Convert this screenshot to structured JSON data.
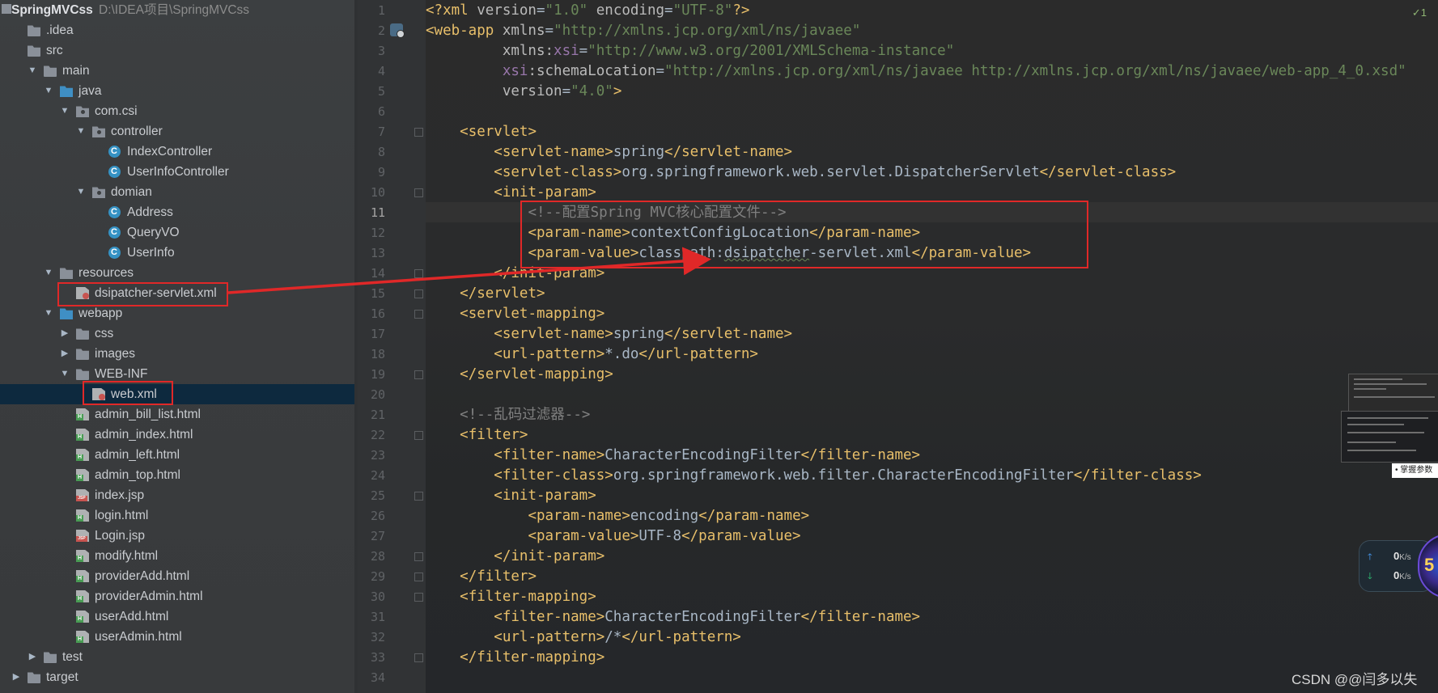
{
  "project": {
    "name": "SpringMVCss",
    "path": "D:\\IDEA项目\\SpringMVCss"
  },
  "tree": [
    {
      "label": "SpringMVCss",
      "indent": 0,
      "arrow": "",
      "icon": "module-icon"
    },
    {
      "label": ".idea",
      "indent": 0,
      "arrow": "",
      "icon": "folder-icon"
    },
    {
      "label": "src",
      "indent": 0,
      "arrow": "",
      "icon": "folder-icon"
    },
    {
      "label": "main",
      "indent": 1,
      "arrow": "open",
      "icon": "folder-icon"
    },
    {
      "label": "java",
      "indent": 2,
      "arrow": "open",
      "icon": "source-folder-icon"
    },
    {
      "label": "com.csi",
      "indent": 3,
      "arrow": "open",
      "icon": "package-icon"
    },
    {
      "label": "controller",
      "indent": 4,
      "arrow": "open",
      "icon": "package-icon"
    },
    {
      "label": "IndexController",
      "indent": 5,
      "arrow": "",
      "icon": "java-class-icon"
    },
    {
      "label": "UserInfoController",
      "indent": 5,
      "arrow": "",
      "icon": "java-class-icon"
    },
    {
      "label": "domian",
      "indent": 4,
      "arrow": "open",
      "icon": "package-icon"
    },
    {
      "label": "Address",
      "indent": 5,
      "arrow": "",
      "icon": "java-class-icon"
    },
    {
      "label": "QueryVO",
      "indent": 5,
      "arrow": "",
      "icon": "java-class-icon"
    },
    {
      "label": "UserInfo",
      "indent": 5,
      "arrow": "",
      "icon": "java-class-icon"
    },
    {
      "label": "resources",
      "indent": 2,
      "arrow": "open",
      "icon": "resources-folder-icon"
    },
    {
      "label": "dsipatcher-servlet.xml",
      "indent": 3,
      "arrow": "",
      "icon": "spring-xml-icon"
    },
    {
      "label": "webapp",
      "indent": 2,
      "arrow": "open",
      "icon": "web-folder-icon"
    },
    {
      "label": "css",
      "indent": 3,
      "arrow": "closed",
      "icon": "folder-icon"
    },
    {
      "label": "images",
      "indent": 3,
      "arrow": "closed",
      "icon": "folder-icon"
    },
    {
      "label": "WEB-INF",
      "indent": 3,
      "arrow": "open",
      "icon": "folder-icon"
    },
    {
      "label": "web.xml",
      "indent": 4,
      "arrow": "",
      "icon": "web-xml-icon",
      "selected": true
    },
    {
      "label": "admin_bill_list.html",
      "indent": 3,
      "arrow": "",
      "icon": "html-file-icon"
    },
    {
      "label": "admin_index.html",
      "indent": 3,
      "arrow": "",
      "icon": "html-file-icon"
    },
    {
      "label": "admin_left.html",
      "indent": 3,
      "arrow": "",
      "icon": "html-file-icon"
    },
    {
      "label": "admin_top.html",
      "indent": 3,
      "arrow": "",
      "icon": "html-file-icon"
    },
    {
      "label": "index.jsp",
      "indent": 3,
      "arrow": "",
      "icon": "jsp-file-icon"
    },
    {
      "label": "login.html",
      "indent": 3,
      "arrow": "",
      "icon": "html-file-icon"
    },
    {
      "label": "Login.jsp",
      "indent": 3,
      "arrow": "",
      "icon": "jsp-file-icon"
    },
    {
      "label": "modify.html",
      "indent": 3,
      "arrow": "",
      "icon": "html-file-icon"
    },
    {
      "label": "providerAdd.html",
      "indent": 3,
      "arrow": "",
      "icon": "html-file-icon"
    },
    {
      "label": "providerAdmin.html",
      "indent": 3,
      "arrow": "",
      "icon": "html-file-icon"
    },
    {
      "label": "userAdd.html",
      "indent": 3,
      "arrow": "",
      "icon": "html-file-icon"
    },
    {
      "label": "userAdmin.html",
      "indent": 3,
      "arrow": "",
      "icon": "html-file-icon"
    },
    {
      "label": "test",
      "indent": 1,
      "arrow": "closed",
      "icon": "folder-icon"
    },
    {
      "label": "target",
      "indent": 0,
      "arrow": "closed",
      "icon": "target-folder-icon"
    }
  ],
  "editor": {
    "inspection_badge": "✓1",
    "current_line": 11,
    "lines": [
      [
        [
          "pi",
          "<?xml "
        ],
        [
          "attr",
          "version"
        ],
        [
          "txt",
          "="
        ],
        [
          "val",
          "\"1.0\""
        ],
        [
          "attr",
          " encoding"
        ],
        [
          "txt",
          "="
        ],
        [
          "val",
          "\"UTF-8\""
        ],
        [
          "pi",
          "?>"
        ]
      ],
      [
        [
          "tag",
          "<web-app "
        ],
        [
          "attr",
          "xmlns"
        ],
        [
          "txt",
          "="
        ],
        [
          "val",
          "\"http://xmlns.jcp.org/xml/ns/javaee\""
        ]
      ],
      [
        [
          "txt",
          "         "
        ],
        [
          "attr",
          "xmlns:"
        ],
        [
          "ns",
          "xsi"
        ],
        [
          "txt",
          "="
        ],
        [
          "val",
          "\"http://www.w3.org/2001/XMLSchema-instance\""
        ]
      ],
      [
        [
          "txt",
          "         "
        ],
        [
          "ns",
          "xsi"
        ],
        [
          "attr",
          ":schemaLocation"
        ],
        [
          "txt",
          "="
        ],
        [
          "val",
          "\"http://xmlns.jcp.org/xml/ns/javaee http://xmlns.jcp.org/xml/ns/javaee/web-app_4_0.xsd\""
        ]
      ],
      [
        [
          "txt",
          "         "
        ],
        [
          "attr",
          "version"
        ],
        [
          "txt",
          "="
        ],
        [
          "val",
          "\"4.0\""
        ],
        [
          "tag",
          ">"
        ]
      ],
      [],
      [
        [
          "txt",
          "    "
        ],
        [
          "tag",
          "<servlet>"
        ]
      ],
      [
        [
          "txt",
          "        "
        ],
        [
          "tag",
          "<servlet-name>"
        ],
        [
          "txt",
          "spring"
        ],
        [
          "tag",
          "</servlet-name>"
        ]
      ],
      [
        [
          "txt",
          "        "
        ],
        [
          "tag",
          "<servlet-class>"
        ],
        [
          "txt",
          "org.springframework.web.servlet.DispatcherServlet"
        ],
        [
          "tag",
          "</servlet-class>"
        ]
      ],
      [
        [
          "txt",
          "        "
        ],
        [
          "tag",
          "<init-param>"
        ]
      ],
      [
        [
          "txt",
          "            "
        ],
        [
          "cmt",
          "<!--配置Spring MVC核心配置文件-->"
        ]
      ],
      [
        [
          "txt",
          "            "
        ],
        [
          "tag",
          "<param-name>"
        ],
        [
          "txt",
          "contextConfigLocation"
        ],
        [
          "tag",
          "</param-name>"
        ]
      ],
      [
        [
          "txt",
          "            "
        ],
        [
          "tag",
          "<param-value>"
        ],
        [
          "txt",
          "classpath:"
        ],
        [
          "squig",
          "dsipatcher"
        ],
        [
          "txt",
          "-servlet.xml"
        ],
        [
          "tag",
          "</param-value>"
        ]
      ],
      [
        [
          "txt",
          "        "
        ],
        [
          "tag",
          "</init-param>"
        ]
      ],
      [
        [
          "txt",
          "    "
        ],
        [
          "tag",
          "</servlet>"
        ]
      ],
      [
        [
          "txt",
          "    "
        ],
        [
          "tag",
          "<servlet-mapping>"
        ]
      ],
      [
        [
          "txt",
          "        "
        ],
        [
          "tag",
          "<servlet-name>"
        ],
        [
          "txt",
          "spring"
        ],
        [
          "tag",
          "</servlet-name>"
        ]
      ],
      [
        [
          "txt",
          "        "
        ],
        [
          "tag",
          "<url-pattern>"
        ],
        [
          "txt",
          "*.do"
        ],
        [
          "tag",
          "</url-pattern>"
        ]
      ],
      [
        [
          "txt",
          "    "
        ],
        [
          "tag",
          "</servlet-mapping>"
        ]
      ],
      [],
      [
        [
          "txt",
          "    "
        ],
        [
          "cmt",
          "<!--乱码过滤器-->"
        ]
      ],
      [
        [
          "txt",
          "    "
        ],
        [
          "tag",
          "<filter>"
        ]
      ],
      [
        [
          "txt",
          "        "
        ],
        [
          "tag",
          "<filter-name>"
        ],
        [
          "txt",
          "CharacterEncodingFilter"
        ],
        [
          "tag",
          "</filter-name>"
        ]
      ],
      [
        [
          "txt",
          "        "
        ],
        [
          "tag",
          "<filter-class>"
        ],
        [
          "txt",
          "org.springframework.web.filter.CharacterEncodingFilter"
        ],
        [
          "tag",
          "</filter-class>"
        ]
      ],
      [
        [
          "txt",
          "        "
        ],
        [
          "tag",
          "<init-param>"
        ]
      ],
      [
        [
          "txt",
          "            "
        ],
        [
          "tag",
          "<param-name>"
        ],
        [
          "txt",
          "encoding"
        ],
        [
          "tag",
          "</param-name>"
        ]
      ],
      [
        [
          "txt",
          "            "
        ],
        [
          "tag",
          "<param-value>"
        ],
        [
          "txt",
          "UTF-8"
        ],
        [
          "tag",
          "</param-value>"
        ]
      ],
      [
        [
          "txt",
          "        "
        ],
        [
          "tag",
          "</init-param>"
        ]
      ],
      [
        [
          "txt",
          "    "
        ],
        [
          "tag",
          "</filter>"
        ]
      ],
      [
        [
          "txt",
          "    "
        ],
        [
          "tag",
          "<filter-mapping>"
        ]
      ],
      [
        [
          "txt",
          "        "
        ],
        [
          "tag",
          "<filter-name>"
        ],
        [
          "txt",
          "CharacterEncodingFilter"
        ],
        [
          "tag",
          "</filter-name>"
        ]
      ],
      [
        [
          "txt",
          "        "
        ],
        [
          "tag",
          "<url-pattern>"
        ],
        [
          "txt",
          "/*"
        ],
        [
          "tag",
          "</url-pattern>"
        ]
      ],
      [
        [
          "txt",
          "    "
        ],
        [
          "tag",
          "</filter-mapping>"
        ]
      ],
      []
    ],
    "fold_lines": [
      7,
      10,
      14,
      15,
      16,
      19,
      22,
      25,
      28,
      29,
      30,
      33
    ]
  },
  "overlays": {
    "speed_up": "0",
    "speed_down": "0",
    "speed_unit": "K/s",
    "speed_badge": "5",
    "thumbnail_caption": "• 掌握参数",
    "watermark": "CSDN @@闫多以失"
  },
  "colors": {
    "annotation_red": "#e02828",
    "selection": "#0d293e",
    "xml_tag": "#e8bf6a",
    "xml_value": "#6a8759",
    "comment": "#808080"
  }
}
